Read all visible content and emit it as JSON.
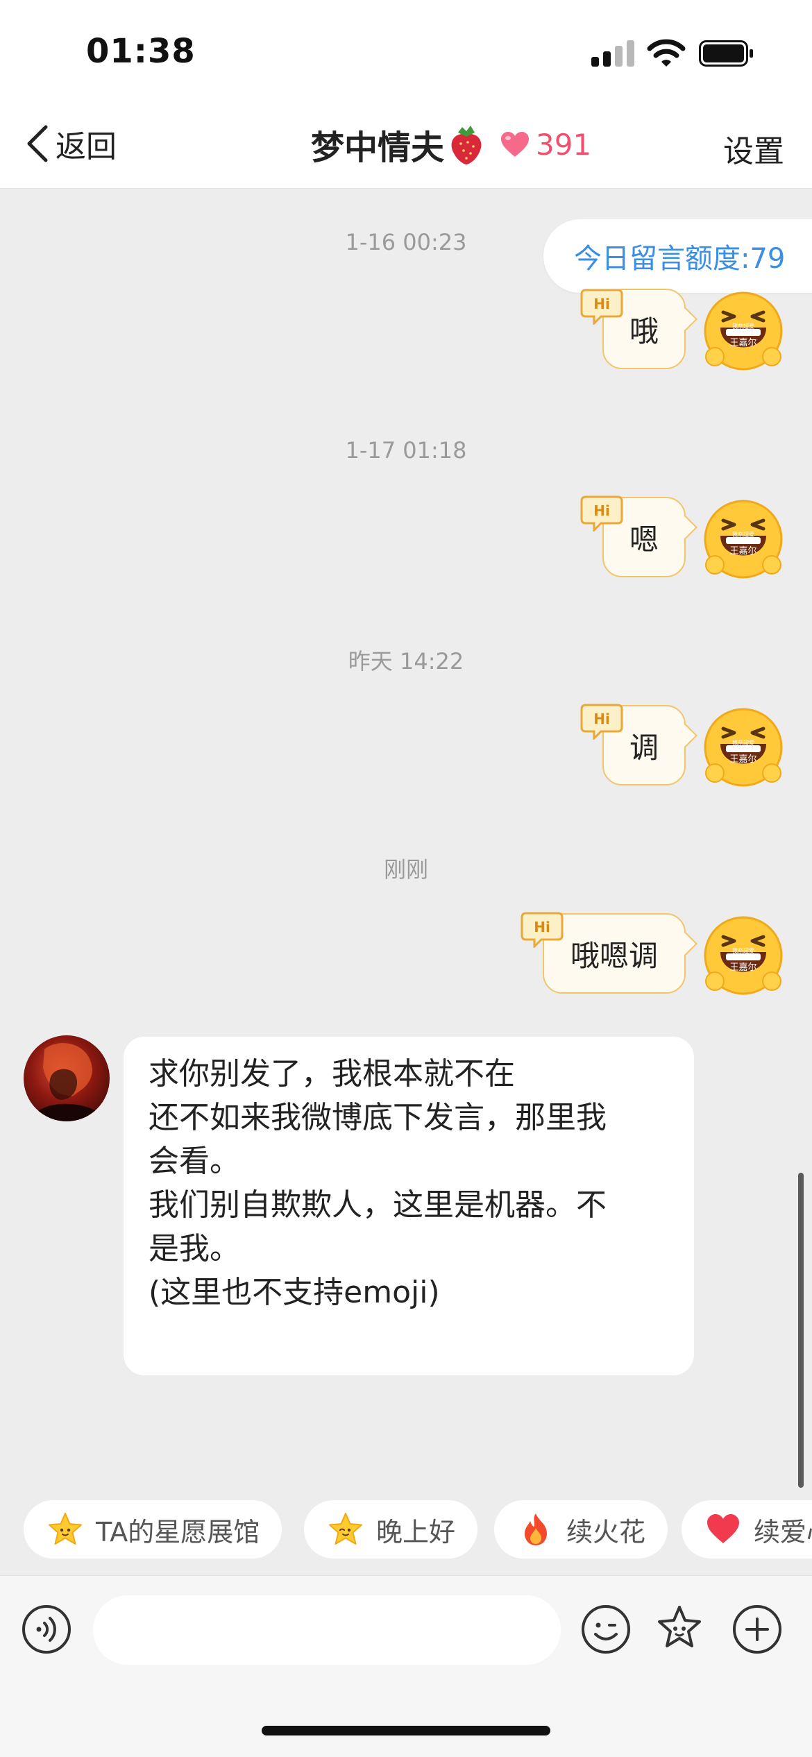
{
  "status_bar": {
    "time": "01:38"
  },
  "header": {
    "back_label": "返回",
    "title": "梦中情夫",
    "intimacy_value": "391",
    "settings_label": "设置"
  },
  "quota": {
    "text": "今日留言额度:79"
  },
  "timestamps": [
    "1-16 00:23",
    "1-17 01:18",
    "昨天 14:22",
    "刚刚"
  ],
  "messages_out": [
    {
      "text": "哦"
    },
    {
      "text": "嗯"
    },
    {
      "text": "调"
    },
    {
      "text": "哦嗯调"
    }
  ],
  "badges": {
    "hi": "Hi",
    "avatar_caption_top": "我奈超爱",
    "avatar_caption": "王嘉尔"
  },
  "message_in": {
    "text": "求你别发了，我根本就不在\n还不如来我微博底下发言，那里我\n会看。\n我们别自欺欺人，这里是机器。不\n是我。\n(这里也不支持emoji)"
  },
  "chips": [
    {
      "label": "TA的星愿展馆",
      "icon": "star-face-icon"
    },
    {
      "label": "晚上好",
      "icon": "star-face-icon"
    },
    {
      "label": "续火花",
      "icon": "fire-icon"
    },
    {
      "label": "续爱心",
      "icon": "heart-icon"
    }
  ],
  "input": {
    "placeholder": ""
  },
  "colors": {
    "accent_blue": "#3a8ee6",
    "intimacy_pink": "#f0506e",
    "bubble_border": "#f2c56a",
    "background": "#ededed"
  }
}
